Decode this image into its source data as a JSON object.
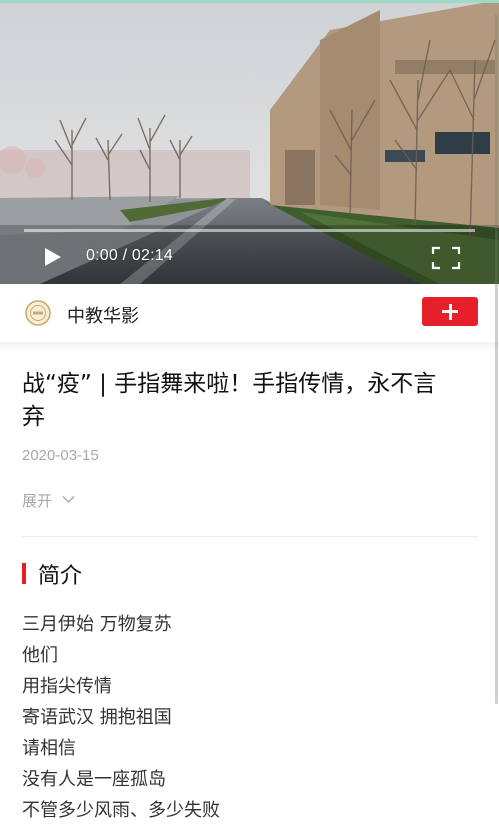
{
  "video": {
    "current_time": "0:00",
    "duration": "02:14",
    "time_display": "0:00 / 02:14",
    "progress": 0,
    "accent_color": "#9fdac8"
  },
  "channel": {
    "name": "中教华影",
    "logo_icon": "channel-logo-icon",
    "follow_icon": "plus-icon",
    "follow_color": "#e5202a"
  },
  "article": {
    "title": "战“疫” | 手指舞来啦！手指传情，永不言弃",
    "title_line1": "战“疫” | 手指舞来啦！手指传情，永不言",
    "title_line2": "弃",
    "date": "2020-03-15",
    "expand_label": "展开",
    "expand_icon": "chevron-down-icon"
  },
  "intro": {
    "heading": "简介",
    "lines": [
      "三月伊始 万物复苏",
      "他们",
      "用指尖传情",
      "寄语武汉 拥抱祖国",
      "请相信",
      "没有人是一座孤岛",
      "不管多少风雨、多少失败"
    ]
  }
}
